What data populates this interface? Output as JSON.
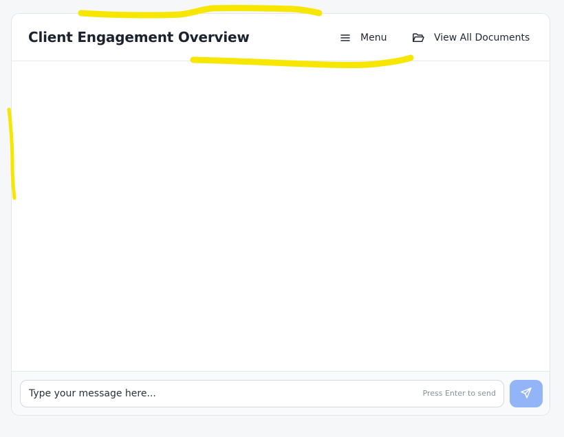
{
  "header": {
    "title": "Client Engagement Overview",
    "menu_label": "Menu",
    "menu_icon": "hamburger-menu-icon",
    "documents_label": "View All Documents",
    "documents_icon": "folder-open-icon"
  },
  "composer": {
    "placeholder": "Type your message here...",
    "hint": "Press Enter to send",
    "send_icon": "send-icon"
  },
  "annotations": {
    "highlighter_color": "#f7e600"
  },
  "colors": {
    "send_button": "#93b4f7",
    "title_text": "#1c2230"
  }
}
